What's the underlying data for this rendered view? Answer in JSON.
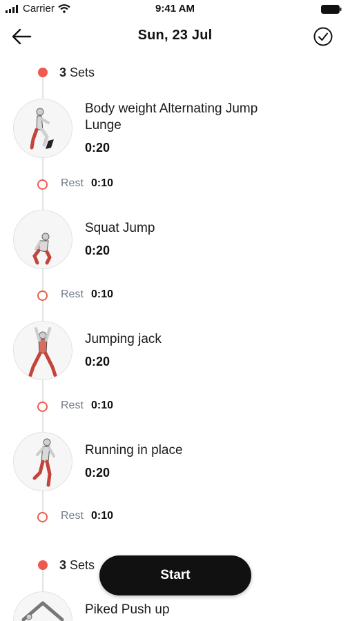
{
  "status_bar": {
    "carrier": "Carrier",
    "time": "9:41 AM"
  },
  "header": {
    "title": "Sun, 23 Jul",
    "back_icon": "arrow-left-icon",
    "confirm_icon": "check-circle-icon"
  },
  "accent_color": "#ef5a4e",
  "groups": [
    {
      "sets_count": "3",
      "sets_label": "Sets",
      "exercises": [
        {
          "name": "Body weight Alternating Jump Lunge",
          "duration": "0:20",
          "rest_label": "Rest",
          "rest": "0:10"
        },
        {
          "name": "Squat Jump",
          "duration": "0:20",
          "rest_label": "Rest",
          "rest": "0:10"
        },
        {
          "name": "Jumping jack",
          "duration": "0:20",
          "rest_label": "Rest",
          "rest": "0:10"
        },
        {
          "name": "Running in place",
          "duration": "0:20",
          "rest_label": "Rest",
          "rest": "0:10"
        }
      ]
    },
    {
      "sets_count": "3",
      "sets_label": "Sets",
      "exercises": [
        {
          "name": "Piked Push up"
        }
      ]
    }
  ],
  "start_button": {
    "label": "Start"
  }
}
